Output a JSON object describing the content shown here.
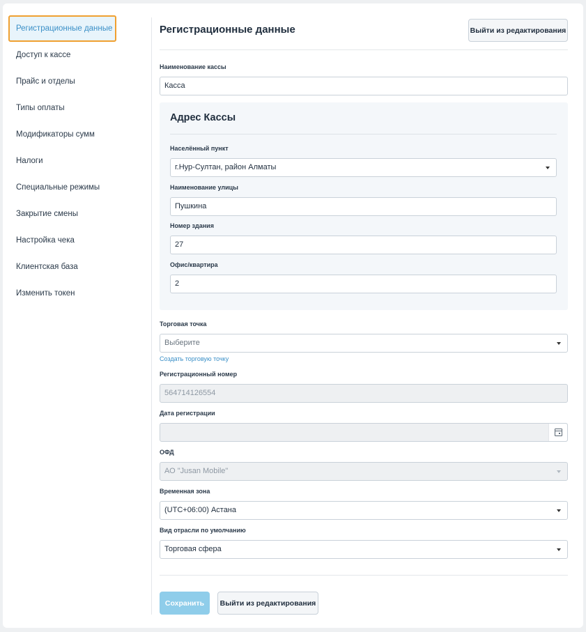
{
  "sidebar": {
    "items": [
      {
        "label": "Регистрационные данные",
        "active": true
      },
      {
        "label": "Доступ к кассе"
      },
      {
        "label": "Прайс и отделы"
      },
      {
        "label": "Типы оплаты"
      },
      {
        "label": "Модификаторы сумм"
      },
      {
        "label": "Налоги"
      },
      {
        "label": "Специальные режимы"
      },
      {
        "label": "Закрытие смены"
      },
      {
        "label": "Настройка чека"
      },
      {
        "label": "Клиентская база"
      },
      {
        "label": "Изменить токен"
      }
    ]
  },
  "header": {
    "title": "Регистрационные данные",
    "exit_button": "Выйти из редактирования"
  },
  "form": {
    "kassa_name": {
      "label": "Наименование кассы",
      "value": "Касса"
    },
    "address": {
      "title": "Адрес Кассы",
      "locality": {
        "label": "Населённый пункт",
        "value": "г.Нур-Султан, район Алматы"
      },
      "street": {
        "label": "Наименование улицы",
        "value": "Пушкина"
      },
      "building": {
        "label": "Номер здания",
        "value": "27"
      },
      "office": {
        "label": "Офис/квартира",
        "value": "2"
      }
    },
    "trade_point": {
      "label": "Торговая точка",
      "placeholder": "Выберите",
      "create_link": "Создать торговую точку"
    },
    "reg_number": {
      "label": "Регистрационный номер",
      "value": "564714126554"
    },
    "reg_date": {
      "label": "Дата регистрации",
      "value": ""
    },
    "ofd": {
      "label": "ОФД",
      "value": "АО \"Jusan Mobile\""
    },
    "timezone": {
      "label": "Временная зона",
      "value": "(UTC+06:00) Астана"
    },
    "industry": {
      "label": "Вид отрасли по умолчанию",
      "value": "Торговая сфера"
    }
  },
  "footer": {
    "save_button": "Сохранить",
    "exit_button": "Выйти из редактирования"
  },
  "colors": {
    "accent": "#3a8fc7",
    "active_outline": "#f0a030",
    "save_button": "#8fcdea"
  }
}
